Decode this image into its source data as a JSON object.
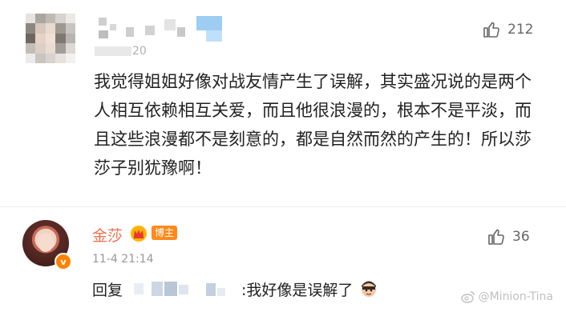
{
  "comment": {
    "likes": "212",
    "time_partial": "20",
    "text": "我觉得姐姐好像对战友情产生了误解，其实盛况说的是两个人相互依赖相互关爱，而且他很浪漫的，根本不是平淡，而且这些浪漫都不是刻意的，都是自然而然的产生的！所以莎莎子别犹豫啊！"
  },
  "reply": {
    "author": "金莎",
    "author_badge": "博主",
    "verified_mark": "v",
    "time": "11-4  21:14",
    "likes": "36",
    "prefix": "回复",
    "suffix": ":我好像是误解了"
  },
  "watermark": {
    "text": "@Minion-Tina"
  },
  "icons": {
    "like": "thumbs-up-icon",
    "crown": "crown-badge-icon",
    "weibo": "weibo-logo-icon",
    "emoji": "face-emoji-icon"
  },
  "colors": {
    "author_name": "#eb7350",
    "host_badge": "#ff8a1c",
    "verified": "#ff8200"
  }
}
